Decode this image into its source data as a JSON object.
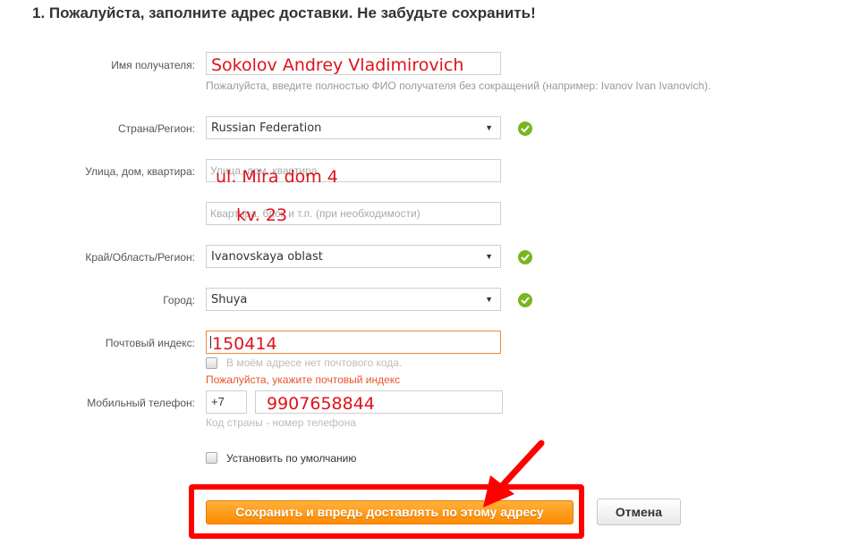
{
  "title": "1. Пожалуйста, заполните адрес доставки. Не забудьте сохранить!",
  "fields": {
    "name": {
      "label": "Имя получателя:",
      "value": "Sokolov Andrey Vladimirovich",
      "hint": "Пожалуйста, введите полностью ФИО получателя без сокращений (например: Ivanov Ivan Ivanovich)."
    },
    "country": {
      "label": "Страна/Регион:",
      "value": "Russian Federation",
      "caret": "▼",
      "status_icon": "check-circle-icon"
    },
    "street": {
      "label": "Улица, дом, квартира:",
      "placeholder": "Улица, дом, квартира",
      "value": "ul. Mira dom 4"
    },
    "street2": {
      "placeholder": "Квартира, блок и т.п. (при необходимости)",
      "value": "kv. 23"
    },
    "region": {
      "label": "Край/Область/Регион:",
      "value": "Ivanovskaya oblast",
      "caret": "▼",
      "status_icon": "check-circle-icon"
    },
    "city": {
      "label": "Город:",
      "value": "Shuya",
      "caret": "▼",
      "status_icon": "check-circle-icon"
    },
    "zip": {
      "label": "Почтовый индекс:",
      "value": "150414",
      "no_zip_checkbox_label": "В моём адресе нет почтового кода.",
      "no_zip_checked": false,
      "error": "Пожалуйста, укажите почтовый индекс"
    },
    "phone": {
      "label": "Мобильный телефон:",
      "country_code": "+7",
      "number": "9907658844",
      "hint": "Код страны - номер телефона"
    },
    "default": {
      "label": "Установить по умолчанию",
      "checked": false
    }
  },
  "buttons": {
    "save": "Сохранить и впредь доставлять по этому адресу",
    "cancel": "Отмена"
  },
  "colors": {
    "accent_orange": "#ff8a00",
    "annotation_red": "#ff0000",
    "handwritten_red": "#e0121b",
    "valid_green": "#7ab51d",
    "error_orange": "#e8542a"
  }
}
